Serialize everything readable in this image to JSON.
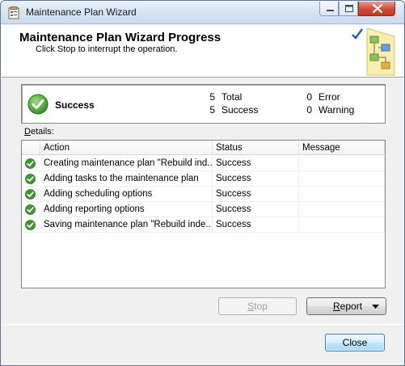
{
  "window": {
    "title": "Maintenance Plan Wizard"
  },
  "header": {
    "title": "Maintenance Plan Wizard Progress",
    "subtitle": "Click Stop to interrupt the operation."
  },
  "summary": {
    "status": "Success",
    "total_count": "5",
    "total_label": "Total",
    "success_count": "5",
    "success_label": "Success",
    "error_count": "0",
    "error_label": "Error",
    "warning_count": "0",
    "warning_label": "Warning"
  },
  "details": {
    "label_accel": "D",
    "label_rest": "etails:",
    "columns": {
      "action": "Action",
      "status": "Status",
      "message": "Message"
    },
    "rows": [
      {
        "action": "Creating maintenance plan \"Rebuild ind...",
        "status": "Success",
        "message": ""
      },
      {
        "action": "Adding tasks to the maintenance plan",
        "status": "Success",
        "message": ""
      },
      {
        "action": "Adding scheduling options",
        "status": "Success",
        "message": ""
      },
      {
        "action": "Adding reporting options",
        "status": "Success",
        "message": ""
      },
      {
        "action": "Saving maintenance plan \"Rebuild inde...",
        "status": "Success",
        "message": ""
      }
    ]
  },
  "buttons": {
    "stop_accel": "S",
    "stop_rest": "top",
    "report_accel": "R",
    "report_rest": "eport",
    "close": "Close"
  },
  "icons": {
    "success": "green-check-icon",
    "app": "maintenance-plan-icon"
  },
  "colors": {
    "success_green": "#3a9a2a",
    "accent_blue": "#3c7fb1"
  }
}
